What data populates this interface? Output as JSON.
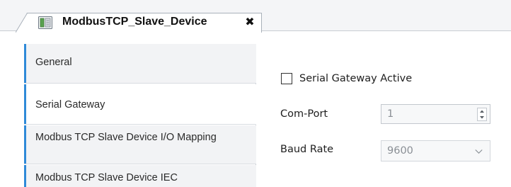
{
  "tab": {
    "title": "ModbusTCP_Slave_Device",
    "close_glyph": "✖",
    "icon": "device-module-icon"
  },
  "sidebar": {
    "items": [
      {
        "label": "General",
        "active": false
      },
      {
        "label": "Serial Gateway",
        "active": true
      },
      {
        "label": "Modbus TCP Slave Device I/O Mapping",
        "active": false
      },
      {
        "label": "Modbus TCP Slave Device IEC",
        "active": false
      }
    ]
  },
  "serial_gateway": {
    "active_checkbox": {
      "label": "Serial Gateway Active",
      "checked": false
    },
    "com_port": {
      "label": "Com-Port",
      "value": "1"
    },
    "baud_rate": {
      "label": "Baud Rate",
      "value": "9600"
    }
  },
  "colors": {
    "accent": "#2f8ad8",
    "sidebar_bg": "#f2f3f5",
    "disabled_text": "#8a8f95"
  }
}
